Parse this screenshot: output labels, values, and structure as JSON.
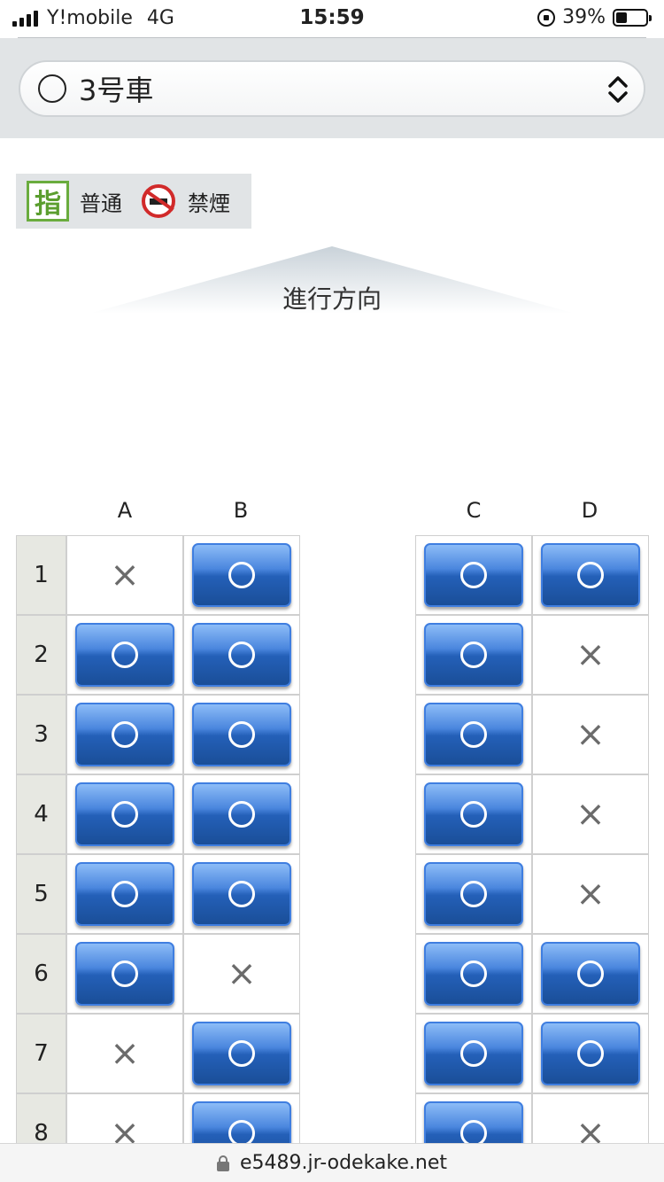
{
  "status_bar": {
    "carrier": "Y!mobile",
    "network": "4G",
    "time": "15:59",
    "battery": "39%",
    "battery_level": 0.39
  },
  "car_selector": {
    "label": "3号車"
  },
  "legend": {
    "reserved_icon_text": "指",
    "reserved_label": "普通",
    "nonsmoking_label": "禁煙"
  },
  "direction": {
    "label": "進行方向"
  },
  "seat_map": {
    "columns": [
      "A",
      "B",
      "C",
      "D"
    ],
    "available_symbol": "available-seat",
    "unavailable_mark": "×",
    "rows": [
      {
        "number": "1",
        "seats": [
          "×",
          "○",
          "○",
          "○"
        ]
      },
      {
        "number": "2",
        "seats": [
          "○",
          "○",
          "○",
          "×"
        ]
      },
      {
        "number": "3",
        "seats": [
          "○",
          "○",
          "○",
          "×"
        ]
      },
      {
        "number": "4",
        "seats": [
          "○",
          "○",
          "○",
          "×"
        ]
      },
      {
        "number": "5",
        "seats": [
          "○",
          "○",
          "○",
          "×"
        ]
      },
      {
        "number": "6",
        "seats": [
          "○",
          "×",
          "○",
          "○"
        ]
      },
      {
        "number": "7",
        "seats": [
          "×",
          "○",
          "○",
          "○"
        ]
      },
      {
        "number": "8",
        "seats": [
          "×",
          "○",
          "○",
          "×"
        ]
      }
    ]
  },
  "url_bar": {
    "domain": "e5489.jr-odekake.net"
  },
  "colors": {
    "seat_button": "#2460b8",
    "reserved_green": "#6aac3e",
    "nonsmoking_red": "#d12a2a",
    "header_band": "#e1e4e6"
  }
}
